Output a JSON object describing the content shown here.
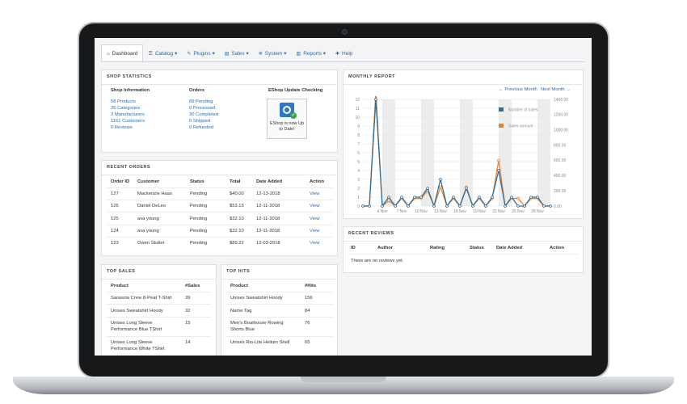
{
  "nav": [
    {
      "label": "Dashboard",
      "icon": "home-icon"
    },
    {
      "label": "Catalog ▾",
      "icon": "list-icon"
    },
    {
      "label": "Plugins ▾",
      "icon": "wrench-icon"
    },
    {
      "label": "Sales ▾",
      "icon": "cart-icon"
    },
    {
      "label": "System ▾",
      "icon": "gear-icon"
    },
    {
      "label": "Reports ▾",
      "icon": "chart-icon"
    },
    {
      "label": "Help",
      "icon": "help-icon"
    }
  ],
  "shop_statistics": {
    "title": "SHOP STATISTICS",
    "info_heading": "Shop Information",
    "info_items": [
      "58 Products",
      "35 Categories",
      "3 Manufacturers",
      "1151 Customers",
      "0 Reviews"
    ],
    "orders_heading": "Orders",
    "orders_items": [
      "89 Pending",
      "0 Processed",
      "30 Completed",
      "0 Shipped",
      "0 Refunded"
    ],
    "update_heading": "EShop Update Checking",
    "update_text": "EShop is now Up to Date!"
  },
  "recent_orders": {
    "title": "RECENT ORDERS",
    "columns": [
      "Order ID",
      "Customer",
      "Status",
      "Total",
      "Date Added",
      "Action"
    ],
    "rows": [
      [
        "127",
        "Mackenzie Haas",
        "Pending",
        "$40.00",
        "12-13-2018",
        "View"
      ],
      [
        "126",
        "Daniel DeLeo",
        "Pending",
        "$53.15",
        "12-11-2018",
        "View"
      ],
      [
        "125",
        "ava young",
        "Pending",
        "$32.10",
        "12-11-2018",
        "View"
      ],
      [
        "124",
        "ava young",
        "Pending",
        "$32.10",
        "12-11-2018",
        "View"
      ],
      [
        "123",
        "Owen Stutler",
        "Pending",
        "$89.22",
        "12-03-2018",
        "View"
      ]
    ]
  },
  "top_sales": {
    "title": "TOP SALES",
    "columns": [
      "Product",
      "#Sales"
    ],
    "rows": [
      {
        "lines": [
          "Sarasota Crew 8-Peat T-Shirt"
        ],
        "value": "39"
      },
      {
        "lines": [
          "Unisex Sweatshirt Hoody"
        ],
        "value": "32"
      },
      {
        "lines": [
          "Unisex Long Sleeve",
          "Performance Blue TShirt"
        ],
        "value": "15"
      },
      {
        "lines": [
          "Unisex Long Sleeve",
          "Performance White TShirt"
        ],
        "value": "14"
      }
    ]
  },
  "top_hits": {
    "title": "TOP HITS",
    "columns": [
      "Product",
      "#Hits"
    ],
    "rows": [
      {
        "lines": [
          "Unisex Sweatshirt Hoody"
        ],
        "value": "156"
      },
      {
        "lines": [
          "Name Tag"
        ],
        "value": "84"
      },
      {
        "lines": [
          "Men's Boathouse Rowing",
          "Shorts Blue"
        ],
        "value": "76"
      },
      {
        "lines": [
          "Unisex Rio-Lite Helium Shell"
        ],
        "value": "65"
      }
    ]
  },
  "monthly_report": {
    "title": "MONTHLY REPORT",
    "prev": "← Previous Month",
    "next": "Next Month →"
  },
  "recent_reviews": {
    "title": "RECENT REVIEWS",
    "columns": [
      "ID",
      "Author",
      "Rating",
      "Status",
      "Date Added",
      "Action"
    ],
    "empty": "There are no reviews yet."
  },
  "colors": {
    "link": "#2a6bb3",
    "orders_line": "#2e6f9e",
    "sales_line": "#e8832a"
  },
  "chart_data": {
    "type": "line",
    "x_tick_labels": [
      "4 Nov",
      "7 Nov",
      "10 Nov",
      "13 Nov",
      "16 Nov",
      "19 Nov",
      "22 Nov",
      "25 Nov",
      "28 Nov"
    ],
    "x": [
      1,
      2,
      3,
      4,
      5,
      6,
      7,
      8,
      9,
      10,
      11,
      12,
      13,
      14,
      15,
      16,
      17,
      18,
      19,
      20,
      21,
      22,
      23,
      24,
      25,
      26,
      27,
      28,
      29,
      30
    ],
    "series": [
      {
        "name": "Number of sales",
        "axis": "left",
        "values": [
          0,
          0,
          12,
          0,
          1,
          0,
          1,
          0,
          1,
          1,
          2,
          0,
          3,
          0,
          1,
          0,
          2,
          0,
          1,
          0,
          1,
          4,
          0,
          1,
          0,
          0,
          1,
          1,
          0,
          0
        ]
      },
      {
        "name": "Sales amount",
        "axis": "right",
        "values": [
          0,
          0,
          1500,
          0,
          70,
          0,
          100,
          0,
          100,
          100,
          200,
          0,
          250,
          0,
          100,
          0,
          250,
          0,
          100,
          0,
          100,
          600,
          0,
          100,
          100,
          0,
          100,
          100,
          0,
          0
        ]
      }
    ],
    "y_left": {
      "ticks": [
        0,
        1,
        2,
        3,
        4,
        5,
        6,
        7,
        8,
        9,
        10,
        11,
        12
      ],
      "range": [
        0,
        12
      ]
    },
    "y_right": {
      "ticks": [
        "0.00",
        "200.00",
        "400.00",
        "600.00",
        "800.00",
        "1000.00",
        "1200.00",
        "1400.00"
      ],
      "range": [
        0,
        1400
      ]
    },
    "legend": "top-right",
    "shaded_bands": true
  }
}
